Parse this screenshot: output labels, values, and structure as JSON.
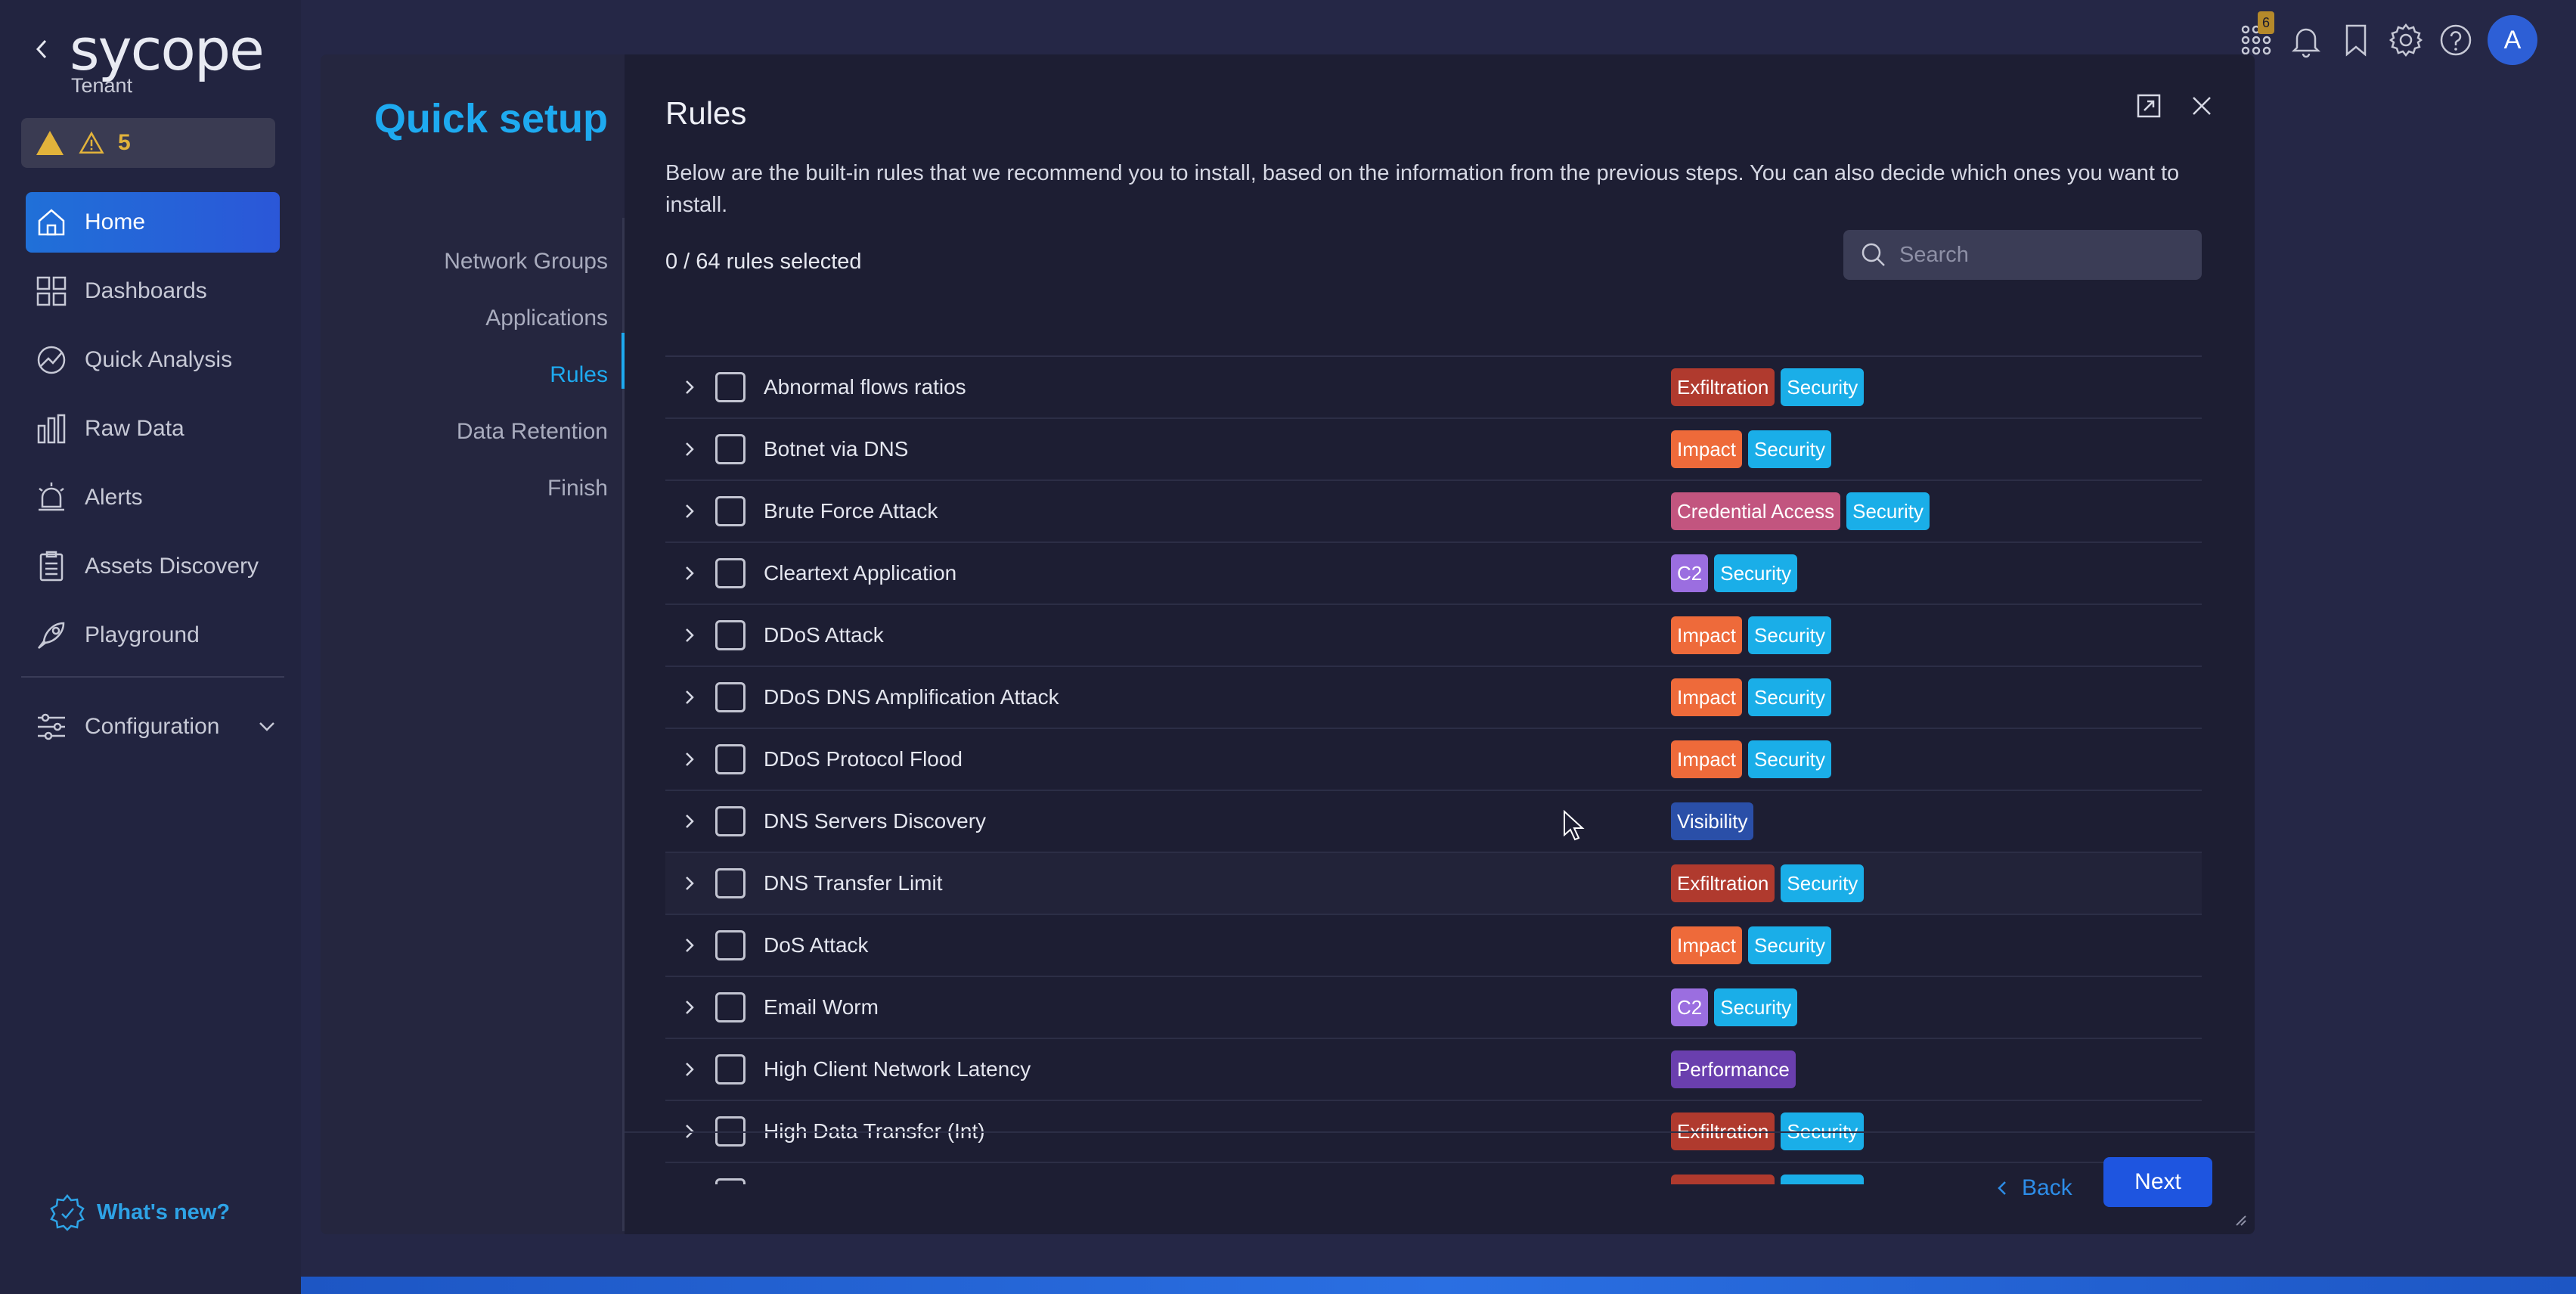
{
  "sidebar": {
    "logo": "sycope",
    "tenant": "Tenant",
    "alert_count": "5",
    "items": [
      {
        "label": "Home",
        "icon": "home-icon"
      },
      {
        "label": "Dashboards",
        "icon": "dashboards-icon"
      },
      {
        "label": "Quick Analysis",
        "icon": "quick-analysis-icon"
      },
      {
        "label": "Raw Data",
        "icon": "raw-data-icon"
      },
      {
        "label": "Alerts",
        "icon": "alerts-icon"
      },
      {
        "label": "Assets Discovery",
        "icon": "assets-discovery-icon"
      },
      {
        "label": "Playground",
        "icon": "playground-icon"
      }
    ],
    "configuration": "Configuration",
    "whats_new": "What's new?"
  },
  "topbar": {
    "notification_badge": "6",
    "avatar_initial": "A"
  },
  "modal": {
    "left_title": "Quick setup",
    "steps": [
      "Network Groups",
      "Applications",
      "Rules",
      "Data Retention",
      "Finish"
    ],
    "active_step": "Rules",
    "title": "Rules",
    "description": "Below are the built-in rules that we recommend you to install, based on the information from the previous steps. You can also decide which ones you want to install.",
    "selected_count": "0 / 64 rules selected",
    "search_placeholder": "Search",
    "back_label": "Back",
    "next_label": "Next"
  },
  "tag_colors": {
    "Exfiltration": "#b03a2e",
    "Security": "#1aaee8",
    "Impact": "#ee6a3a",
    "Credential Access": "#c2557f",
    "C2": "#9b6ee0",
    "Visibility": "#2a4fa8",
    "Performance": "#6a3fae"
  },
  "rules": [
    {
      "name": "Abnormal flows ratios",
      "tags": [
        "Exfiltration",
        "Security"
      ]
    },
    {
      "name": "Botnet via DNS",
      "tags": [
        "Impact",
        "Security"
      ]
    },
    {
      "name": "Brute Force Attack",
      "tags": [
        "Credential Access",
        "Security"
      ]
    },
    {
      "name": "Cleartext Application",
      "tags": [
        "C2",
        "Security"
      ]
    },
    {
      "name": "DDoS Attack",
      "tags": [
        "Impact",
        "Security"
      ]
    },
    {
      "name": "DDoS DNS Amplification Attack",
      "tags": [
        "Impact",
        "Security"
      ]
    },
    {
      "name": "DDoS Protocol Flood",
      "tags": [
        "Impact",
        "Security"
      ]
    },
    {
      "name": "DNS Servers Discovery",
      "tags": [
        "Visibility"
      ]
    },
    {
      "name": "DNS Transfer Limit",
      "tags": [
        "Exfiltration",
        "Security"
      ]
    },
    {
      "name": "DoS Attack",
      "tags": [
        "Impact",
        "Security"
      ]
    },
    {
      "name": "Email Worm",
      "tags": [
        "C2",
        "Security"
      ]
    },
    {
      "name": "High Client Network Latency",
      "tags": [
        "Performance"
      ]
    },
    {
      "name": "High Data Transfer (Int)",
      "tags": [
        "Exfiltration",
        "Security"
      ]
    },
    {
      "name": "",
      "tags": [
        "Exfiltration",
        "Security"
      ]
    }
  ]
}
